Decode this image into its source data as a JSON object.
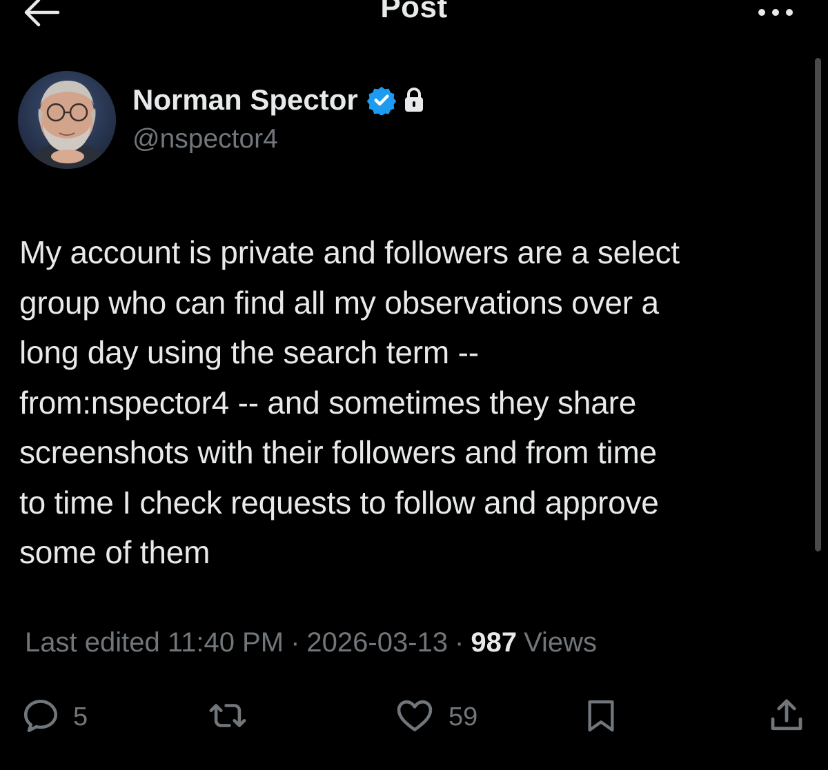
{
  "header": {
    "title": "Post"
  },
  "author": {
    "name": "Norman Spector",
    "handle": "@nspector4",
    "verified": true,
    "protected": true
  },
  "post": {
    "text": "My account is private and followers are a select\ngroup who can find all my observations over a\nlong day using the search term --\nfrom:nspector4 -- and sometimes they share\nscreenshots with their followers and from time\nto time I check requests to follow and approve\nsome of them",
    "edited_label": "Last edited 11:40 PM",
    "date": "2026-03-13",
    "separator": "·",
    "views_count": "987",
    "views_label": "Views"
  },
  "actions": {
    "reply_count": "5",
    "like_count": "59"
  },
  "colors": {
    "background": "#000000",
    "text": "#e7e9ea",
    "muted": "#71767b",
    "verified": "#1d9bf0"
  },
  "icons": [
    "back-arrow-icon",
    "more-icon",
    "verified-icon",
    "lock-icon",
    "reply-icon",
    "repost-icon",
    "like-icon",
    "bookmark-icon",
    "share-icon"
  ]
}
